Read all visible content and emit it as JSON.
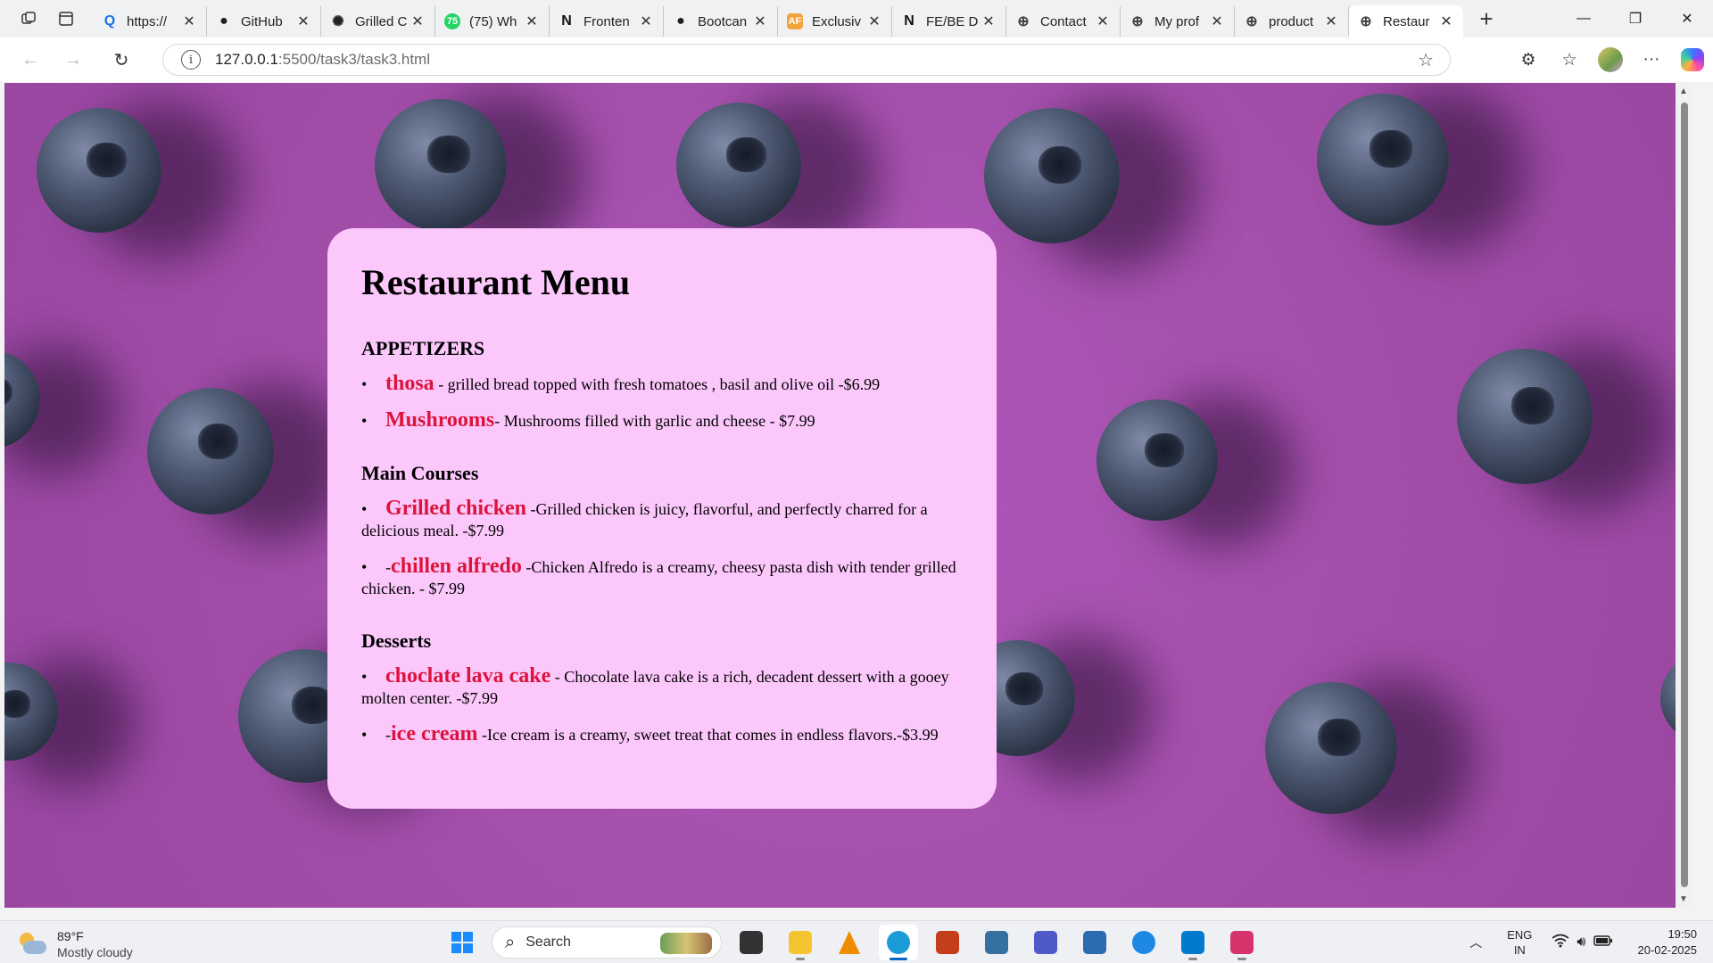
{
  "browser": {
    "tabs": [
      {
        "title": "https://",
        "favicon": "search-favicon",
        "color": "#1a73e8",
        "glyph": "Q",
        "active": false
      },
      {
        "title": "GitHub",
        "favicon": "github-favicon",
        "color": "#1f1f1f",
        "glyph": "●",
        "active": false
      },
      {
        "title": "Grilled C",
        "favicon": "openai-favicon",
        "color": "#222222",
        "glyph": "✺",
        "active": false
      },
      {
        "title": "(75) Wh",
        "favicon": "whatsapp-favicon",
        "color": "#25d366",
        "glyph": "75",
        "active": false
      },
      {
        "title": "Fronten",
        "favicon": "notion-favicon",
        "color": "#111111",
        "glyph": "N",
        "active": false
      },
      {
        "title": "Bootcan",
        "favicon": "github-favicon",
        "color": "#1f1f1f",
        "glyph": "●",
        "active": false
      },
      {
        "title": "Exclusiv",
        "favicon": "af-favicon",
        "color": "#f2a53a",
        "glyph": "AF",
        "active": false
      },
      {
        "title": "FE/BE D",
        "favicon": "notion-favicon",
        "color": "#111111",
        "glyph": "N",
        "active": false
      },
      {
        "title": "Contact",
        "favicon": "globe-favicon",
        "color": "#444444",
        "glyph": "⊕",
        "active": false
      },
      {
        "title": "My prof",
        "favicon": "globe-favicon",
        "color": "#444444",
        "glyph": "⊕",
        "active": false
      },
      {
        "title": "product",
        "favicon": "globe-favicon",
        "color": "#444444",
        "glyph": "⊕",
        "active": false
      },
      {
        "title": "Restaur",
        "favicon": "globe-favicon",
        "color": "#444444",
        "glyph": "⊕",
        "active": true
      }
    ],
    "close_glyph": "✕",
    "new_tab_glyph": "+",
    "url_host": "127.0.0.1",
    "url_rest": ":5500/task3/task3.html"
  },
  "page": {
    "title": "Restaurant Menu",
    "bullet": "•",
    "sections": [
      {
        "heading": "APPETIZERS",
        "items": [
          {
            "prefix": "",
            "name": "thosa",
            "desc": " - grilled bread topped with fresh tomatoes , basil and olive oil -$6.99"
          },
          {
            "prefix": "",
            "name": "Mushrooms",
            "desc": "- Mushrooms filled with garlic and cheese - $7.99"
          }
        ]
      },
      {
        "heading": "Main Courses",
        "items": [
          {
            "prefix": "",
            "name": "Grilled chicken",
            "desc": " -Grilled chicken is juicy, flavorful, and perfectly charred for a delicious meal. -$7.99"
          },
          {
            "prefix": "-",
            "name": "chillen alfredo",
            "desc": " -Chicken Alfredo is a creamy, cheesy pasta dish with tender grilled chicken. - $7.99"
          }
        ]
      },
      {
        "heading": "Desserts",
        "items": [
          {
            "prefix": "",
            "name": "choclate lava cake",
            "desc": " - Chocolate lava cake is a rich, decadent dessert with a gooey molten center. -$7.99"
          },
          {
            "prefix": "-",
            "name": "ice cream",
            "desc": " -Ice cream is a creamy, sweet treat that comes in endless flavors.-$3.99"
          }
        ]
      }
    ],
    "colors": {
      "card_bg": "#fcc8fc",
      "item_name": "#dc143c",
      "background": "#a24ea9"
    }
  },
  "taskbar": {
    "weather_temp": "89°F",
    "weather_cond": "Mostly cloudy",
    "search_label": "Search",
    "apps": [
      {
        "name": "task-view-app",
        "color": "#333333",
        "active": false,
        "running": false
      },
      {
        "name": "file-explorer-app",
        "color": "#f4c430",
        "active": false,
        "running": true
      },
      {
        "name": "vlc-app",
        "color": "#f08c00",
        "active": false,
        "running": false
      },
      {
        "name": "edge-app",
        "color": "#1c9bd9",
        "active": true,
        "running": true
      },
      {
        "name": "powerpoint-app",
        "color": "#c43e1c",
        "active": false,
        "running": false
      },
      {
        "name": "python-app",
        "color": "#3670a0",
        "active": false,
        "running": false
      },
      {
        "name": "teams-app",
        "color": "#5059c9",
        "active": false,
        "running": false
      },
      {
        "name": "window-app",
        "color": "#2b6cb0",
        "active": false,
        "running": false
      },
      {
        "name": "help-app",
        "color": "#1e88e5",
        "active": false,
        "running": false
      },
      {
        "name": "vscode-app",
        "color": "#007acc",
        "active": false,
        "running": true
      },
      {
        "name": "snipping-tool-app",
        "color": "#d6336c",
        "active": false,
        "running": true
      }
    ],
    "lang_top": "ENG",
    "lang_bottom": "IN",
    "time": "19:50",
    "date": "20-02-2025"
  }
}
